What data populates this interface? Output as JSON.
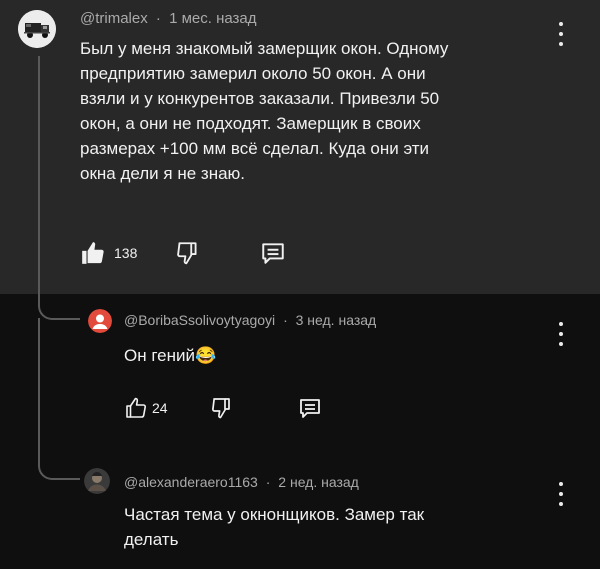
{
  "comment1": {
    "author": "@trimalex",
    "time": "1 мес. назад",
    "lines": [
      "Был у меня знакомый замерщик окон. Одному",
      "предприятию замерил около 50 окон. А они",
      "взяли и у конкурентов заказали. Привезли 50",
      "окон, а они не подходят. Замерщик в своих",
      "размерах +100 мм всё сделал. Куда они эти",
      "окна дели я не знаю."
    ],
    "likes": "138"
  },
  "reply1": {
    "author": "@BoribaSsolivoytyagoyi",
    "time": "3 нед. назад",
    "text": "Он гений",
    "emoji": "😂",
    "likes": "24",
    "avatar_color": "#e24a3b"
  },
  "reply2": {
    "author": "@alexanderaero1163",
    "time": "2 нед. назад",
    "lines": [
      "Частая тема у окнонщиков. Замер так",
      "делать"
    ]
  },
  "separator": "·",
  "icons": {
    "like": "thumbs-up-icon",
    "dislike": "thumbs-down-icon",
    "reply": "comment-icon",
    "menu": "more-vert-icon"
  }
}
